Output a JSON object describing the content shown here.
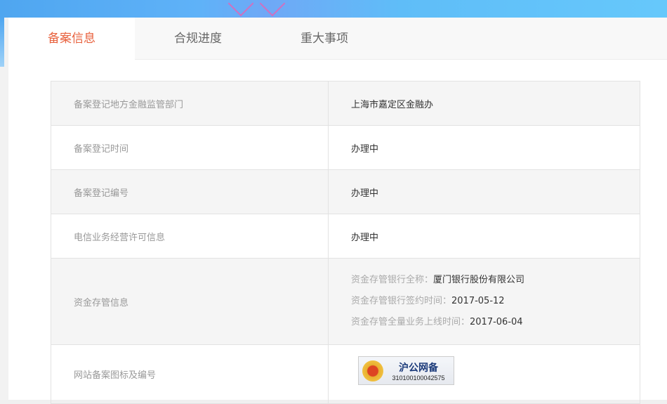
{
  "tabs": [
    {
      "label": "备案信息",
      "active": true
    },
    {
      "label": "合规进度"
    },
    {
      "label": "重大事项"
    }
  ],
  "rows": [
    {
      "key": "备案登记地方金融监管部门",
      "value": "上海市嘉定区金融办"
    },
    {
      "key": "备案登记时间",
      "value": "办理中"
    },
    {
      "key": "备案登记编号",
      "value": "办理中"
    },
    {
      "key": "电信业务经营许可信息",
      "value": "办理中"
    },
    {
      "key": "资金存管信息",
      "lines": [
        {
          "label": "资金存管银行全称：",
          "value": "厦门银行股份有限公司"
        },
        {
          "label": "资金存管银行签约时间：",
          "value": "2017-05-12"
        },
        {
          "label": "资金存管全量业务上线时间：",
          "value": "2017-06-04"
        }
      ]
    },
    {
      "key": "网站备案图标及编号",
      "badge": {
        "title": "沪公网备",
        "number": "310100100042575"
      }
    }
  ],
  "colors": {
    "accent": "#e8603c"
  }
}
